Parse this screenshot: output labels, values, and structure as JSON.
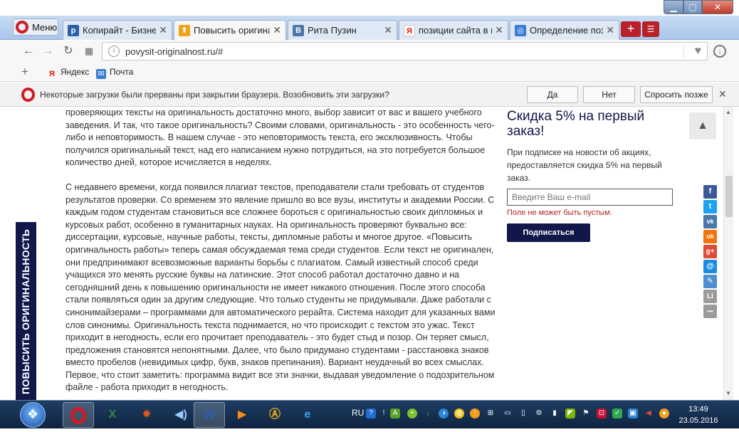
{
  "browser": {
    "menu_label": "Меню",
    "tabs": [
      {
        "title": "Копирайт - БизнесПл",
        "favicon": "p",
        "color": "#2c5fa8"
      },
      {
        "title": "Повысить оригинальн",
        "favicon": "⬆",
        "color": "#f0a01a",
        "active": true
      },
      {
        "title": "Рита Пузин",
        "favicon": "В",
        "color": "#4a76a8"
      },
      {
        "title": "позиции сайта в поис",
        "favicon": "Я",
        "color": "#ffffff"
      },
      {
        "title": "Определение позици",
        "favicon": "◎",
        "color": "#3a7bd5"
      }
    ],
    "new_tab": "+",
    "url": "povysit-originalnost.ru/#",
    "bookmarks": [
      "Яндекс",
      "Почта"
    ],
    "infobar": {
      "message": "Некоторые загрузки были прерваны при закрытии браузера. Возобновить эти загрузки?",
      "yes": "Да",
      "no": "Нет",
      "later": "Спросить позже"
    }
  },
  "page": {
    "side_tab": "ПОВЫСИТЬ ОРИГИНАЛЬНОСТЬ",
    "article": {
      "p1": "проверяющих тексты на оригинальность достаточно много, выбор зависит от вас и вашего учебного заведения. И так, что такое оригинальность? Своими словами, оригинальность - это особенность чего-либо и неповторимость. В нашем случае - это неповторимость текста, его эксклюзивность. Чтобы получился оригинальный текст, над его написанием нужно потрудиться, на это потребуется большое количество дней, которое исчисляется в неделях.",
      "p2": "С недавнего времени, когда появился плагиат текстов, преподаватели стали требовать от студентов результатов проверки. Со временем это явление пришло во все вузы, институты и академии России. С каждым годом студентам становиться все сложнее бороться с оригинальностью своих дипломных и курсовых работ, особенно в гуманитарных науках. На оригинальность проверяют буквально все: диссертации, курсовые, научные работы, тексты, дипломные работы и многое другое. «Повысить оригинальность работы» теперь самая обсуждаемая тема среди студентов. Если текст не оригинален, они предпринимают всевозможные варианты борьбы с плагиатом. Самый известный способ среди учащихся это менять русские буквы на латинские. Этот способ работал достаточно давно и на сегодняшний день к повышению оригинальности не имеет никакого отношения. После этого способа стали появляться один за другим следующие. Что только студенты не придумывали. Даже работали с синонимайзерами – программами для автоматического рерайта. Система находит для указанных вами слов синонимы. Оригинальность текста поднимается, но что происходит с текстом это ужас. Текст приходит в негодность, если его прочитает преподаватель - это будет стыд и позор. Он теряет смысл, предложения становятся непонятными.  Далее, что было придумано студентами - расстановка знаков вместо пробелов (невидимых цифр, букв, знаков препинания). Вариант неудачный во всех смыслах. Первое, что стоит заметить: программа видит все эти значки, выдавая уведомление о подозрительном файле - работа приходит в негодность."
    },
    "promo": {
      "heading": "Скидка 5% на первый заказ!",
      "description": "При подписке на новости об акциях, предоставляется скидка 5% на первый заказ.",
      "email_placeholder": "Введите Ваш e-mail",
      "error": "Поле не может быть пустым.",
      "subscribe": "Подписаться"
    },
    "share_buttons": [
      {
        "icon": "facebook-icon",
        "glyph": "f",
        "color": "#3b5998"
      },
      {
        "icon": "twitter-icon",
        "glyph": "t",
        "color": "#1da1f2"
      },
      {
        "icon": "vk-icon",
        "glyph": "vk",
        "color": "#4a76a8"
      },
      {
        "icon": "odnoklassniki-icon",
        "glyph": "ok",
        "color": "#f2720c"
      },
      {
        "icon": "google-plus-icon",
        "glyph": "g+",
        "color": "#dd4b39"
      },
      {
        "icon": "mail-icon",
        "glyph": "@",
        "color": "#168de2"
      },
      {
        "icon": "livejournal-icon",
        "glyph": "✎",
        "color": "#4f8fd0"
      },
      {
        "icon": "liveinternet-icon",
        "glyph": "Li",
        "color": "#9b9b9b"
      },
      {
        "icon": "more-icon",
        "glyph": "•••",
        "color": "#9b9b9b"
      }
    ]
  },
  "taskbar": {
    "language": "RU",
    "time": "13:49",
    "date": "23.05.2016"
  }
}
